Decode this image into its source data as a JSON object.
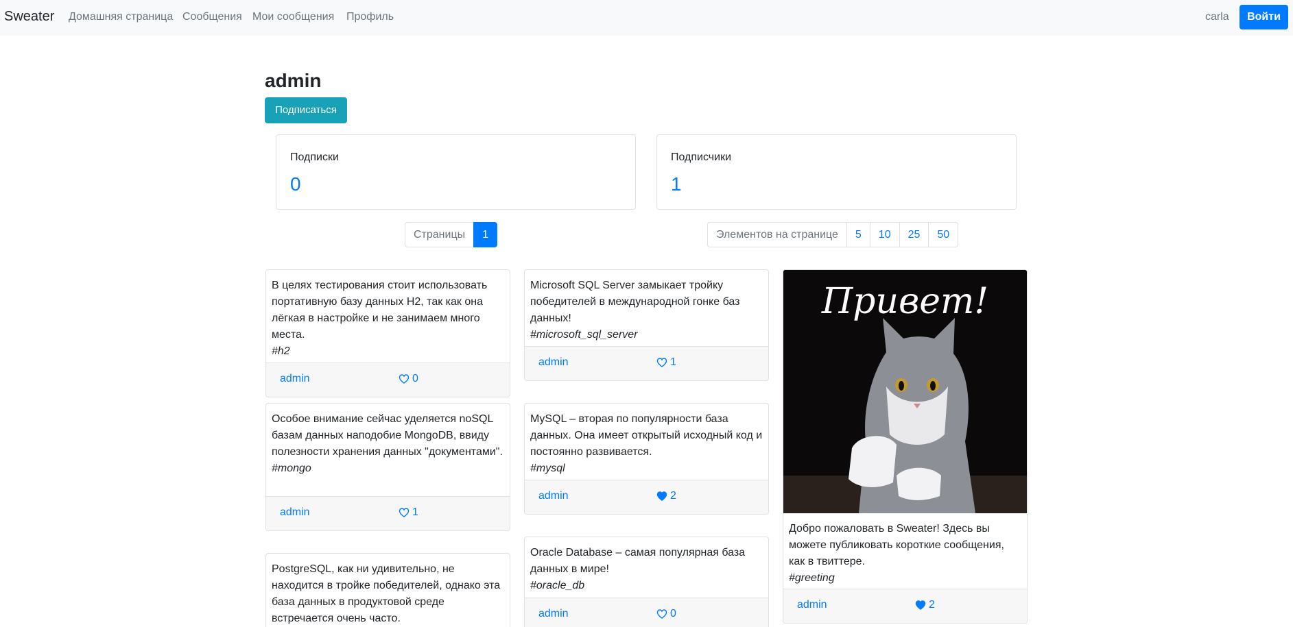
{
  "navbar": {
    "brand": "Sweater",
    "links": [
      "Домашняя страница",
      "Сообщения",
      "Мои сообщения",
      "Профиль"
    ],
    "user": "carla",
    "login_label": "Войти"
  },
  "profile": {
    "name": "admin",
    "subscribe_label": "Подписаться",
    "subscriptions_label": "Подписки",
    "subscriptions_count": "0",
    "subscribers_label": "Подписчики",
    "subscribers_count": "1"
  },
  "pagination": {
    "pages_label": "Страницы",
    "current_page": "1",
    "per_page_label": "Элементов на странице",
    "per_page_options": [
      "5",
      "10",
      "25",
      "50"
    ]
  },
  "messages": [
    {
      "text": "В целях тестирования стоит использовать портативную базу данных H2, так как она лёгкая в настройке и не занимаем много места.",
      "tag": "#h2",
      "author": "admin",
      "likes": "0",
      "liked": false
    },
    {
      "text": "Особое внимание сейчас уделяется noSQL базам данных наподобие MongoDB, ввиду полезности хранения данных \"документами\".",
      "tag": "#mongo",
      "author": "admin",
      "likes": "1",
      "liked": false
    },
    {
      "text": "PostgreSQL, как ни удивительно, не находится в тройке победителей, однако эта база данных в продуктовой среде встречается очень часто.",
      "tag": "",
      "author": "",
      "likes": "",
      "liked": false
    },
    {
      "text": "Microsoft SQL Server замыкает тройку победителей в международной гонке баз данных!",
      "tag": "#microsoft_sql_server",
      "author": "admin",
      "likes": "1",
      "liked": false
    },
    {
      "text": "MySQL – вторая по популярности база данных. Она имеет открытый исходный код и постоянно развивается.",
      "tag": "#mysql",
      "author": "admin",
      "likes": "2",
      "liked": true
    },
    {
      "text": "Oracle Database – самая популярная база данных в мире!",
      "tag": "#oracle_db",
      "author": "admin",
      "likes": "0",
      "liked": false
    },
    {
      "image_text": "Привет!",
      "text": "Добро пожаловать в Sweater! Здесь вы можете публиковать короткие сообщения, как в твиттере.",
      "tag": "#greeting",
      "author": "admin",
      "likes": "2",
      "liked": true
    }
  ]
}
